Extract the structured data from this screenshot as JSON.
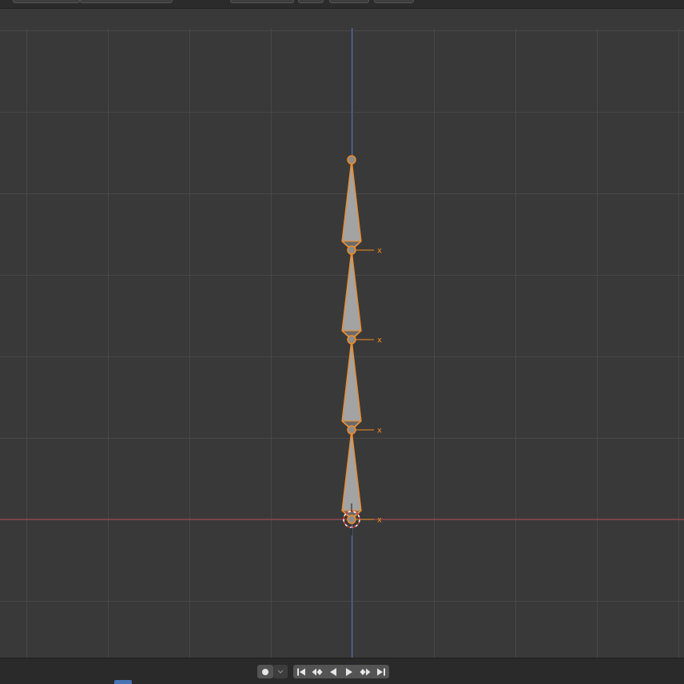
{
  "viewport": {
    "axis_x_color": "#b24852",
    "axis_z_color": "#4a6fc1",
    "grid_color": "#444444",
    "background": "#393939",
    "bone_color": "#a3a3a3",
    "selection_color": "#f28b22",
    "bone_axis_label": "x"
  },
  "toolbar": {
    "record_icon": "record-icon",
    "keying_dropdown_icon": "chevron-down-icon",
    "playback_icons": [
      "jump-to-start-icon",
      "jump-to-keyframe-previous-icon",
      "play-reverse-icon",
      "play-icon",
      "jump-to-keyframe-next-icon",
      "jump-to-end-icon"
    ]
  }
}
